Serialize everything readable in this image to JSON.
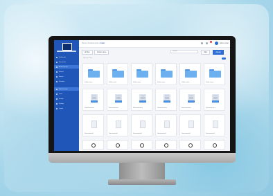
{
  "app": {
    "breadcrumb_root": "Home / All documents /",
    "breadcrumb_current": "Folder",
    "user_name": "Admin User",
    "accent_color": "#2d6fd6",
    "sidebar_color": "#1f56b8"
  },
  "sidebar": {
    "items": [
      {
        "label": "Dashboard",
        "active": false
      },
      {
        "label": "Documents",
        "active": false
      },
      {
        "label": "All documents",
        "active": true
      },
      {
        "label": "Shared",
        "active": false
      },
      {
        "label": "Recent",
        "active": false
      },
      {
        "label": "Favorites",
        "active": false
      },
      {
        "label": "Administration",
        "active": true
      },
      {
        "label": "Users",
        "active": false
      },
      {
        "label": "Groups",
        "active": false
      },
      {
        "label": "Settings",
        "active": false
      },
      {
        "label": "Logout",
        "active": false
      }
    ]
  },
  "toolbar": {
    "all_label": "All files",
    "folder_label": "Folder name",
    "search_placeholder": "Search",
    "filter_label": "Filter",
    "upload_label": "Upload",
    "more_label": "More"
  },
  "subbar": {
    "text": "Sort by name"
  },
  "files": [
    {
      "type": "folder",
      "name": "Folder name"
    },
    {
      "type": "folder",
      "name": "Folder name"
    },
    {
      "type": "folder",
      "name": "Folder name"
    },
    {
      "type": "folder",
      "name": "Folder name"
    },
    {
      "type": "folder",
      "name": "Folder name"
    },
    {
      "type": "folder",
      "name": "Folder name"
    },
    {
      "type": "doc",
      "name": "Document.docx"
    },
    {
      "type": "doc",
      "name": "Document.docx"
    },
    {
      "type": "doc",
      "name": "Document.docx"
    },
    {
      "type": "doc",
      "name": "Document.docx"
    },
    {
      "type": "doc",
      "name": "Document.docx"
    },
    {
      "type": "doc",
      "name": "Document.docx"
    },
    {
      "type": "page",
      "name": "Document.pdf"
    },
    {
      "type": "page",
      "name": "Document.pdf"
    },
    {
      "type": "page",
      "name": "Document.pdf"
    },
    {
      "type": "page",
      "name": "Document.pdf"
    },
    {
      "type": "page",
      "name": "Document.pdf"
    },
    {
      "type": "page",
      "name": "Document.pdf"
    },
    {
      "type": "ring",
      "name": ""
    },
    {
      "type": "ring",
      "name": ""
    },
    {
      "type": "ring",
      "name": ""
    },
    {
      "type": "ring",
      "name": ""
    },
    {
      "type": "ring",
      "name": ""
    },
    {
      "type": "ring",
      "name": ""
    }
  ]
}
